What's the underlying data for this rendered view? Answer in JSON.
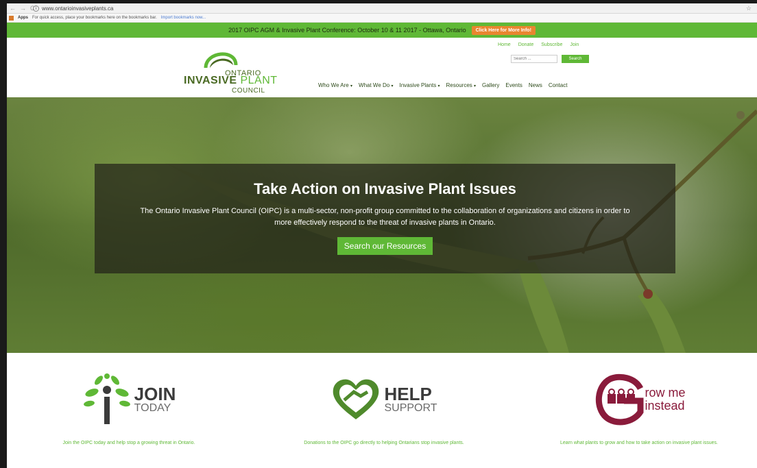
{
  "browser": {
    "url": "www.ontarioinvasiveplants.ca",
    "bookmarks_apps": "Apps",
    "bookmarks_hint": "For quick access, place your bookmarks here on the bookmarks bar.",
    "bookmarks_import": "Import bookmarks now..."
  },
  "announcement": {
    "text": "2017 OIPC AGM & Invasive Plant Conference: October 10 & 11 2017 - Ottawa, Ontario",
    "cta": "Click Here for More Info!"
  },
  "logo": {
    "line1": "ONTARIO",
    "line2a": "INVASIVE",
    "line2b": "PLANT",
    "line3": "COUNCIL"
  },
  "utility_links": [
    "Home",
    "Donate",
    "Subscribe",
    "Join"
  ],
  "search": {
    "placeholder": "Search ...",
    "button": "Search"
  },
  "menu": [
    {
      "label": "Who We Are",
      "caret": "▾"
    },
    {
      "label": "What We Do",
      "caret": "▾"
    },
    {
      "label": "Invasive Plants",
      "caret": "▾"
    },
    {
      "label": "Resources",
      "caret": "▾"
    },
    {
      "label": "Gallery",
      "caret": ""
    },
    {
      "label": "Events",
      "caret": ""
    },
    {
      "label": "News",
      "caret": ""
    },
    {
      "label": "Contact",
      "caret": ""
    }
  ],
  "hero": {
    "title": "Take Action on Invasive Plant Issues",
    "text": "The Ontario Invasive Plant Council (OIPC) is a multi-sector, non-profit group committed to the collaboration of organizations and citizens in order to more effectively respond to the threat of invasive plants in Ontario.",
    "button": "Search our Resources"
  },
  "features": {
    "join": {
      "big": "JOIN",
      "small": "TODAY",
      "caption": "Join the OIPC today and help stop a growing threat in Ontario."
    },
    "help": {
      "big": "HELP",
      "small": "SUPPORT",
      "caption": "Donations to the OIPC go directly to helping Ontarians stop invasive plants."
    },
    "grow": {
      "word_a": "row me",
      "word_b": "instead",
      "caption": "Learn what plants to grow and how to take action on invasive plant issues."
    }
  },
  "colors": {
    "brand_green": "#5fb836",
    "dark_green": "#4a6a23",
    "cta_orange": "#e9862f",
    "grow_maroon": "#8a1b3b"
  }
}
